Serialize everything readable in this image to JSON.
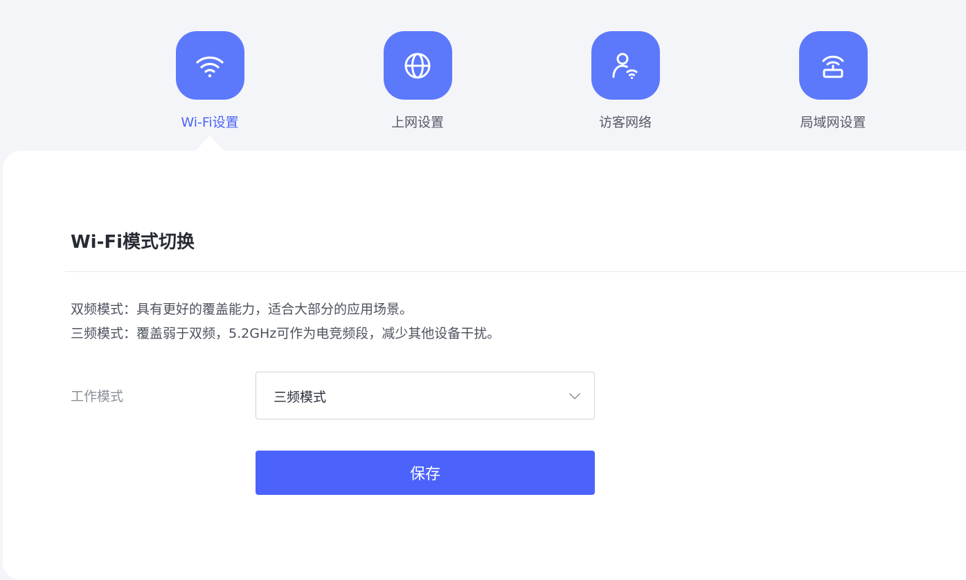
{
  "nav": {
    "items": [
      {
        "label": "Wi-Fi设置",
        "icon": "wifi-icon",
        "active": true
      },
      {
        "label": "上网设置",
        "icon": "globe-icon",
        "active": false
      },
      {
        "label": "访客网络",
        "icon": "guest-user-wifi-icon",
        "active": false
      },
      {
        "label": "局域网设置",
        "icon": "router-icon",
        "active": false
      }
    ]
  },
  "section": {
    "title": "Wi-Fi模式切换",
    "desc_line1": "双频模式：具有更好的覆盖能力，适合大部分的应用场景。",
    "desc_line2": "三频模式：覆盖弱于双频，5.2GHz可作为电竞频段，减少其他设备干扰。"
  },
  "form": {
    "work_mode_label": "工作模式",
    "work_mode_value": "三频模式",
    "save_label": "保存"
  },
  "colors": {
    "accent": "#4c63fb",
    "icon_bg": "#5c79fb",
    "active_label": "#4c64f6",
    "page_bg": "#f4f5f9",
    "panel_bg": "#ffffff"
  }
}
